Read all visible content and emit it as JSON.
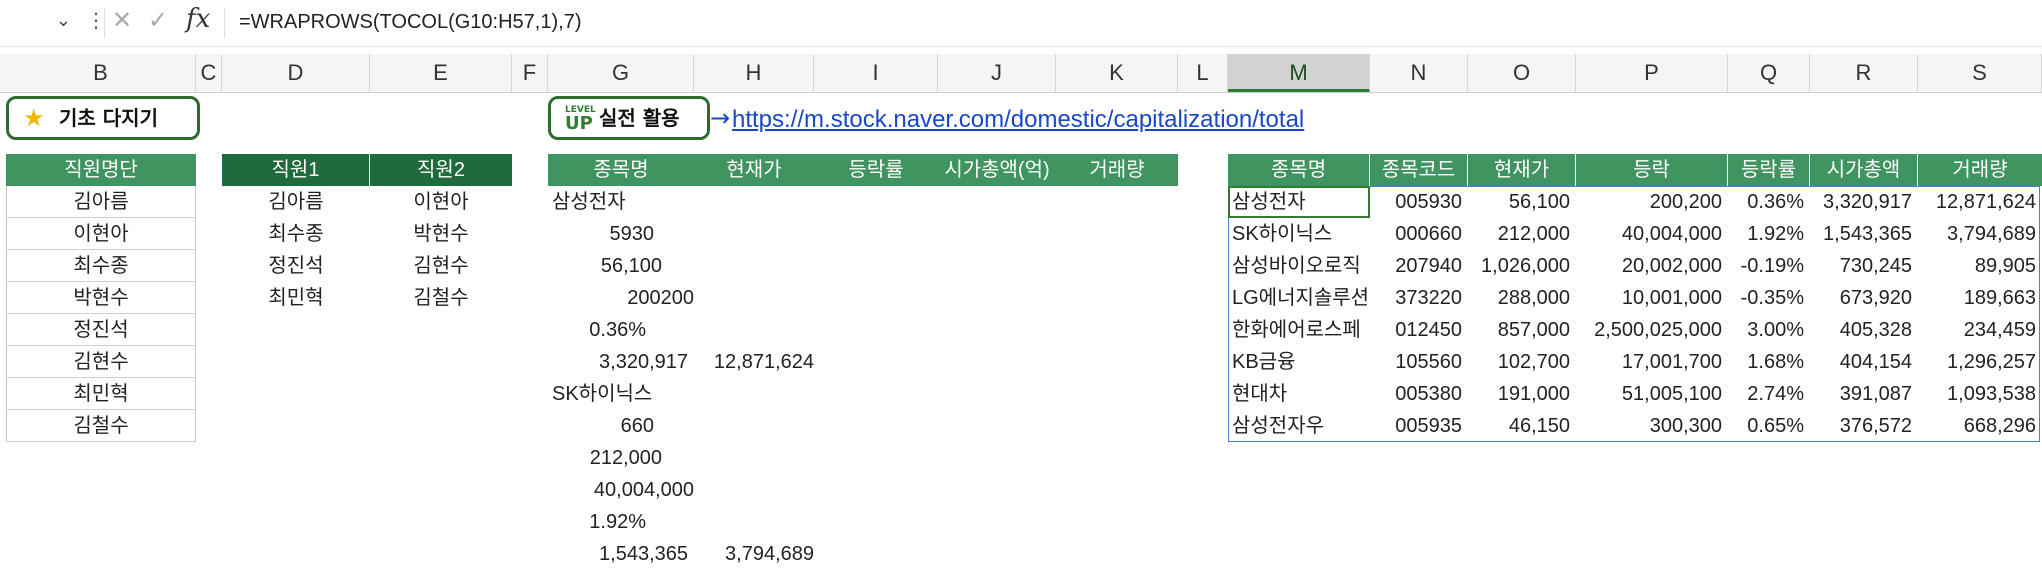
{
  "formula_bar": {
    "formula": "=WRAPROWS(TOCOL(G10:H57,1),7)",
    "fx_label": "fx",
    "cancel_icon": "close-icon",
    "enter_icon": "check-icon"
  },
  "columns": [
    "B",
    "C",
    "D",
    "E",
    "F",
    "G",
    "H",
    "I",
    "J",
    "K",
    "L",
    "M",
    "N",
    "O",
    "P",
    "Q",
    "R",
    "S"
  ],
  "selected_column": "M",
  "buttons": {
    "basic": "기초 다지기",
    "level_badge": "LEVEL",
    "level_up": "UP",
    "practice": "실전 활용"
  },
  "link": "https://m.stock.naver.com/domestic/capitalization/total",
  "link_arrow": "→",
  "employee_list": {
    "header": "직원명단",
    "names": [
      "김아름",
      "이현아",
      "최수종",
      "박현수",
      "정진석",
      "김현수",
      "최민혁",
      "김철수"
    ]
  },
  "pairs": {
    "headers": [
      "직원1",
      "직원2"
    ],
    "rows": [
      [
        "김아름",
        "이현아"
      ],
      [
        "최수종",
        "박현수"
      ],
      [
        "정진석",
        "김현수"
      ],
      [
        "최민혁",
        "김철수"
      ]
    ]
  },
  "raw": {
    "headers": [
      "종목명",
      "현재가",
      "등락률",
      "시가총액(억)",
      "거래량"
    ],
    "g_values": [
      "삼성전자",
      "5930",
      "56,100",
      "200200",
      "0.36%",
      "3,320,917",
      "SK하이닉스",
      "660",
      "212,000",
      "40,004,000",
      "1.92%",
      "1,543,365"
    ],
    "h_values": {
      "r6": "12,871,624",
      "r12": "3,794,689"
    }
  },
  "result": {
    "headers": [
      "종목명",
      "종목코드",
      "현재가",
      "등락",
      "등락률",
      "시가총액",
      "거래량"
    ],
    "rows": [
      [
        "삼성전자",
        "005930",
        "56,100",
        "200,200",
        "0.36%",
        "3,320,917",
        "12,871,624"
      ],
      [
        "SK하이닉스",
        "000660",
        "212,000",
        "40,004,000",
        "1.92%",
        "1,543,365",
        "3,794,689"
      ],
      [
        "삼성바이오로직",
        "207940",
        "1,026,000",
        "20,002,000",
        "-0.19%",
        "730,245",
        "89,905"
      ],
      [
        "LG에너지솔루션",
        "373220",
        "288,000",
        "10,001,000",
        "-0.35%",
        "673,920",
        "189,663"
      ],
      [
        "한화에어로스페",
        "012450",
        "857,000",
        "2,500,025,000",
        "3.00%",
        "405,328",
        "234,459"
      ],
      [
        "KB금융",
        "105560",
        "102,700",
        "17,001,700",
        "1.68%",
        "404,154",
        "1,296,257"
      ],
      [
        "현대차",
        "005380",
        "191,000",
        "51,005,100",
        "2.74%",
        "391,087",
        "1,093,538"
      ],
      [
        "삼성전자우",
        "005935",
        "46,150",
        "300,300",
        "0.65%",
        "376,572",
        "668,296"
      ]
    ]
  },
  "colors": {
    "header_green": "#3f9460",
    "header_dark_green": "#1f6b3c",
    "accent": "#2e7d32",
    "link_blue": "#1a47c8"
  }
}
